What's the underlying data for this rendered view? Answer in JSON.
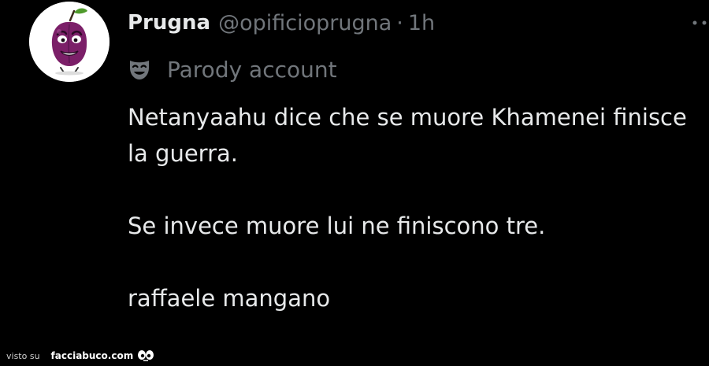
{
  "tweet": {
    "display_name": "Prugna",
    "handle": "@opificioprugna",
    "separator": "·",
    "time": "1h",
    "account_label": "Parody account",
    "body": [
      "Netanyaahu dice che se muore Khamenei finisce la guerra.",
      "Se invece muore lui ne finiscono tre.",
      "raffaele mangano"
    ]
  },
  "watermark": {
    "prefix": "visto su",
    "site": "facciabuco.com"
  },
  "icons": {
    "avatar": "plum-character-avatar",
    "account_label": "theater-mask-icon",
    "menu": "more-options-icon",
    "watermark": "eyes-icon"
  },
  "colors": {
    "background": "#000000",
    "primary_text": "#e7e9ea",
    "secondary_text": "#71767b",
    "plum": "#7b1f68",
    "leaf": "#4f9a2b"
  }
}
